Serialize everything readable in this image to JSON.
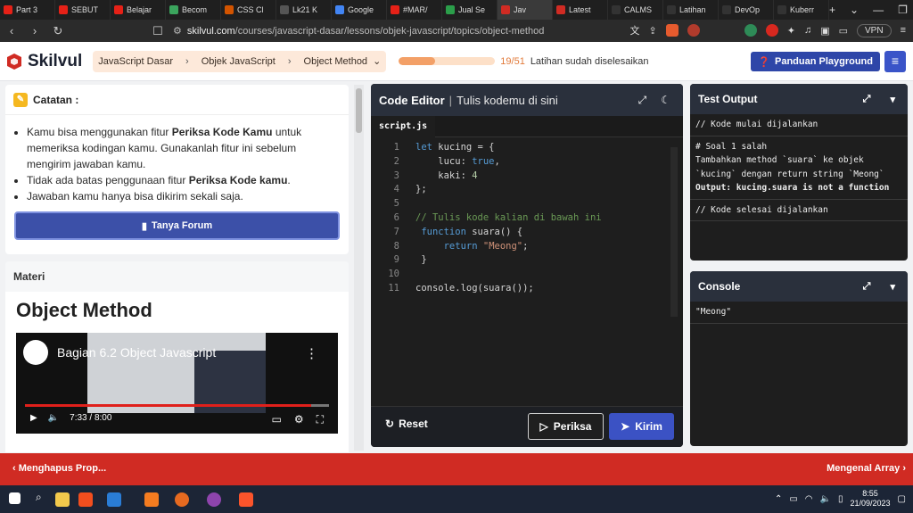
{
  "browser": {
    "tabs": [
      {
        "label": "Part 3",
        "color": "#e62117"
      },
      {
        "label": "SEBUT",
        "color": "#e62117"
      },
      {
        "label": "Belajar",
        "color": "#e62117"
      },
      {
        "label": "Becom",
        "color": "#3ba55d"
      },
      {
        "label": "CSS Cl",
        "color": "#d35400"
      },
      {
        "label": "Lk21 K",
        "color": "#555555"
      },
      {
        "label": "Google",
        "color": "#4285f4"
      },
      {
        "label": "#MAR/",
        "color": "#e62117"
      },
      {
        "label": "Jual Se",
        "color": "#2b9e4a"
      },
      {
        "label": "Jav",
        "color": "#d02b23",
        "active": true
      },
      {
        "label": "Latest",
        "color": "#d02b23"
      },
      {
        "label": "CALMS",
        "color": "#333333"
      },
      {
        "label": "Latihan",
        "color": "#333333"
      },
      {
        "label": "DevOp",
        "color": "#333333"
      },
      {
        "label": "Kuberr",
        "color": "#333333"
      }
    ],
    "url_host": "skilvul.com",
    "url_path": "/courses/javascript-dasar/lessons/objek-javascript/topics/object-method",
    "vpn_label": "VPN"
  },
  "header": {
    "logo_text": "Skilvul",
    "breadcrumbs": [
      "JavaScript Dasar",
      "Objek JavaScript",
      "Object Method"
    ],
    "progress": {
      "fraction": 0.3725,
      "count": "19/51",
      "label": "Latihan sudah diselesaikan"
    },
    "panduan_label": "Panduan Playground"
  },
  "notes": {
    "title": "Catatan :",
    "items": [
      [
        "Kamu bisa menggunakan fitur ",
        "Periksa Kode Kamu",
        " untuk memeriksa kodingan kamu. Gunakanlah fitur ini sebelum mengirim jawaban kamu."
      ],
      [
        "Tidak ada batas penggunaan fitur ",
        "Periksa Kode kamu",
        "."
      ],
      [
        "Jawaban kamu hanya bisa dikirim sekali saja.",
        "",
        ""
      ]
    ],
    "forum_label": "Tanya Forum"
  },
  "materi": {
    "label": "Materi",
    "title": "Object Method",
    "video": {
      "title": "Bagian 6.2 Object Javascript",
      "time": "7:33 / 8:00",
      "progress": 0.94
    }
  },
  "editor": {
    "title": "Code Editor",
    "subtitle": "Tulis kodemu di sini",
    "filename": "script.js",
    "reset_label": "Reset",
    "periksa_label": "Periksa",
    "kirim_label": "Kirim"
  },
  "test_output": {
    "title": "Test Output",
    "lines": [
      "// Kode mulai dijalankan",
      "# Soal 1 salah",
      "Tambahkan method `suara` ke objek",
      "`kucing` dengan return string `Meong`",
      "Output: kucing.suara is not a function",
      "// Kode selesai dijalankan"
    ]
  },
  "console": {
    "title": "Console",
    "output": "\"Meong\""
  },
  "bottom_nav": {
    "prev_label": "Menghapus Prop...",
    "next_label": "Mengenal Array"
  },
  "taskbar": {
    "time": "8:55",
    "date": "21/09/2023"
  }
}
